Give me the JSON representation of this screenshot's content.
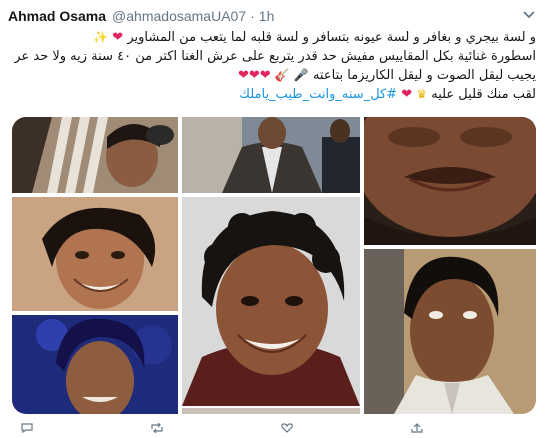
{
  "tweet": {
    "display_name": "Ahmad Osama",
    "handle": "@ahmadosamaUA07",
    "separator": "·",
    "time": "1h",
    "lines": [
      "و لسة بيجري و بغافر و لسة عيونه بتسافر و لسة قلبه لما يتعب من المشاوير",
      "اسطورة غنائية بكل المقاييس مفيش حد قدر يتربع على عرش الغنا اكتر من ٤٠ سنة زيه ولا حد عرف",
      "يجيب ليقل الصوت و ليقل الكاريزما بتاعته",
      "لقب منك قليل عليه"
    ],
    "hashtag": "#كل_سنه_وانت_طيب_ياملك"
  },
  "colors": {
    "name": "#14171a",
    "meta": "#657786",
    "hashtag": "#1b95e0",
    "heart": "#e0245e"
  },
  "icons": [
    "chevron-down-icon",
    "heart-icon",
    "music-note-icon",
    "microphone-icon",
    "sparkle-icon",
    "crown-icon",
    "reply-icon",
    "retweet-icon",
    "like-icon",
    "share-icon"
  ]
}
